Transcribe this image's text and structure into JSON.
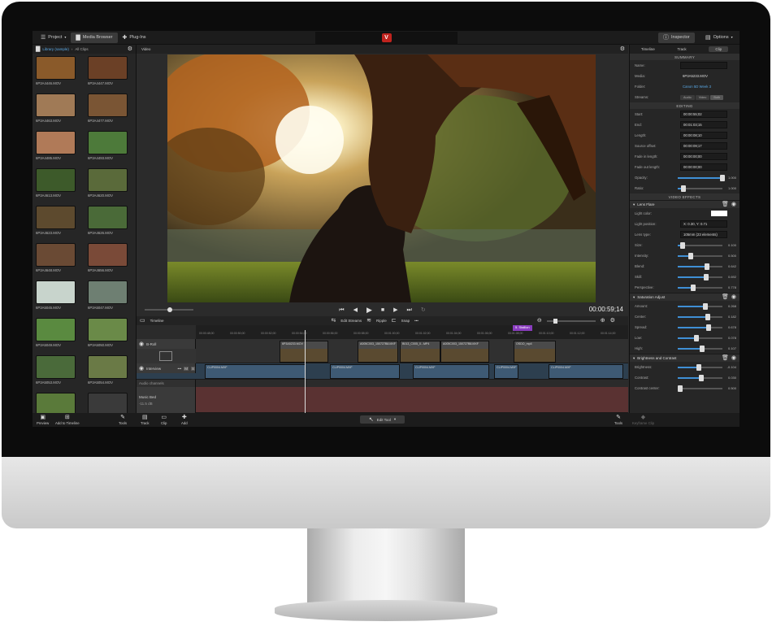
{
  "topbar": {
    "project": "Project",
    "media_browser": "Media Browser",
    "plugins": "Plug-Ins",
    "inspector": "Inspector",
    "options": "Options"
  },
  "left": {
    "crumb_root": "Library (sample)",
    "crumb_current": "All Clips",
    "clips": [
      "6P3A4446.MOV",
      "6P3A4447.MOV",
      "6P3A4463.MOV",
      "6P3A4477.MOV",
      "6P3A4485.MOV",
      "6P3A4493.MOV",
      "6P3A4613.MOV",
      "6P3A4620.MOV",
      "6P3A4623.MOV",
      "6P3A4626.MOV",
      "6P3A4648.MOV",
      "6P3A4656.MOV",
      "6P3A5045.MOV",
      "6P3A5047.MOV",
      "6P3A5049.MOV",
      "6P3A5050.MOV",
      "6P3A5053.MOV",
      "6P3A5054.MOV",
      "",
      ""
    ],
    "clip_colors": [
      "#8a5a2a",
      "#6b4026",
      "#a07a56",
      "#7a5534",
      "#b07a58",
      "#4d7a3a",
      "#3d5a2a",
      "#5a6a3a",
      "#5d4a2e",
      "#4a6a38",
      "#6a4a34",
      "#7a4a38",
      "#c8d4cc",
      "#6e7f72",
      "#5a8a40",
      "#6a8a48",
      "#4a6a3a",
      "#6a7a46",
      "#5a7a3a",
      "#3a3a3a"
    ]
  },
  "viewer": {
    "label": "Video",
    "timecode": "00:00:59;14"
  },
  "timeline": {
    "label": "Timeline",
    "edit_streams": "Edit Streams",
    "ripple": "Ripple",
    "snap": "Snap",
    "marker": "5. Stallion",
    "ruler": [
      "00:00:48;00",
      "00:00:50;00",
      "00:00:52;00",
      "00:00:54;00",
      "00:00:56;00",
      "00:00:58;00",
      "00:01:00;00",
      "00:01:02;00",
      "00:01:04;00",
      "00:01:06;00",
      "00:01:08;00",
      "00:01:10;00",
      "00:01:12;00",
      "00:01:14;00"
    ],
    "tracks": {
      "broll": "B-Roll",
      "interview": "Interview",
      "audio_channels": "Audio channels",
      "music": "Music Bed",
      "db": "-11.5 dB",
      "m": "M",
      "s": "S"
    },
    "broll_clips": [
      "6P3A5233.MOV",
      "A005C003_150727B8.MXF",
      "B013_C005_0...MP4",
      "A005C003_150727B8.MXF",
      "OSDO_mp4"
    ],
    "interview_clips": [
      "CLIP0004.MXF",
      "CLIP0004.MXF",
      "CLIP0004.MXF",
      "CLIP0004.MXF",
      "CLIP0004.MXF",
      "CLIP0004.MXF"
    ]
  },
  "inspector": {
    "tabs": [
      "Timeline",
      "Track",
      "Clip"
    ],
    "summary": "SUMMARY",
    "editing": "EDITING",
    "video_effects": "VIDEO EFFECTS",
    "name_label": "Name:",
    "media_label": "Media:",
    "media": "6P3A5233.MOV",
    "folder_label": "Folder:",
    "folder": "Canon 5D Week 3",
    "streams_label": "Streams:",
    "streams": [
      "Audio",
      "Video",
      "Both"
    ],
    "start_label": "Start:",
    "start": "00:00:55;02",
    "end_label": "End:",
    "end": "00:01:03;15",
    "length_label": "Length:",
    "length": "00:00:08;10",
    "offset_label": "Source offset:",
    "offset": "00:00:09;17",
    "fadein_label": "Fade in length:",
    "fadein": "00:00:00;00",
    "fadeout_label": "Fade out length:",
    "fadeout": "00:00:00;00",
    "opacity_label": "Opacity:",
    "opacity": "1.000",
    "ratio_label": "Ratio:",
    "ratio": "1.000",
    "lens_flare": "Lens Flare",
    "light_color": "Light color:",
    "light_position": "Light position:",
    "light_position_val": "X: 0.30, Y: 0.71",
    "lens_type": "Lens type:",
    "lens_type_val": "105mm (23 elements)",
    "lf_sliders": [
      {
        "label": "Size:",
        "value": "0.100",
        "pct": 0.05
      },
      {
        "label": "Intensity:",
        "value": "0.500",
        "pct": 0.25
      },
      {
        "label": "Blend:",
        "value": "0.642",
        "pct": 0.64
      },
      {
        "label": "Skill:",
        "value": "0.692",
        "pct": 0.62
      },
      {
        "label": "Perspective:",
        "value": "0.778",
        "pct": 0.3
      }
    ],
    "saturation": "Saturation Adjust",
    "sat_sliders": [
      {
        "label": "Amount:",
        "value": "0.268",
        "pct": 0.6
      },
      {
        "label": "Center:",
        "value": "0.182",
        "pct": 0.65
      },
      {
        "label": "Spread:",
        "value": "0.678",
        "pct": 0.68
      },
      {
        "label": "Low:",
        "value": "0.078",
        "pct": 0.38
      },
      {
        "label": "High:",
        "value": "0.107",
        "pct": 0.52
      }
    ],
    "brightness": "Brightness and Contrast",
    "bc_sliders": [
      {
        "label": "Brightness:",
        "value": "-0.104",
        "pct": 0.45
      },
      {
        "label": "Contrast:",
        "value": "0.030",
        "pct": 0.5
      },
      {
        "label": "Contrast center:",
        "value": "0.500",
        "pct": 0.0
      }
    ]
  },
  "bottombar": {
    "preview": "Preview",
    "add_timeline": "Add to Timeline",
    "tools": "Tools",
    "track": "Track",
    "clip": "Clip",
    "add": "Add",
    "edit_tool": "Edit Tool",
    "tools2": "Tools",
    "keyframe": "Keyframe Clip"
  }
}
